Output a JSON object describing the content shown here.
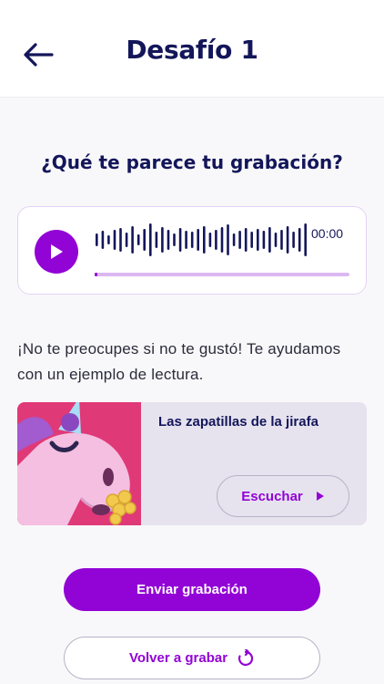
{
  "header": {
    "title": "Desafío 1",
    "back_icon": "arrow-left-icon"
  },
  "question": "¿Qué te parece tu grabación?",
  "player": {
    "play_icon": "play-icon",
    "time": "00:00",
    "progress": 0.0,
    "accent": "#9203d6",
    "track_color": "#dcb8f3"
  },
  "helper_text": "¡No te preocupes si no te gustó! Te ayudamos con un ejemplo de lectura.",
  "example": {
    "title": "Las zapatillas de la jirafa",
    "listen_label": "Escuchar",
    "listen_icon": "play-icon",
    "image": "unicorn-illustration"
  },
  "actions": {
    "send_label": "Enviar grabación",
    "retry_label": "Volver a grabar",
    "retry_icon": "retry-icon"
  },
  "colors": {
    "primary": "#9203d6",
    "heading": "#14165a",
    "background": "#f8f8fa"
  }
}
